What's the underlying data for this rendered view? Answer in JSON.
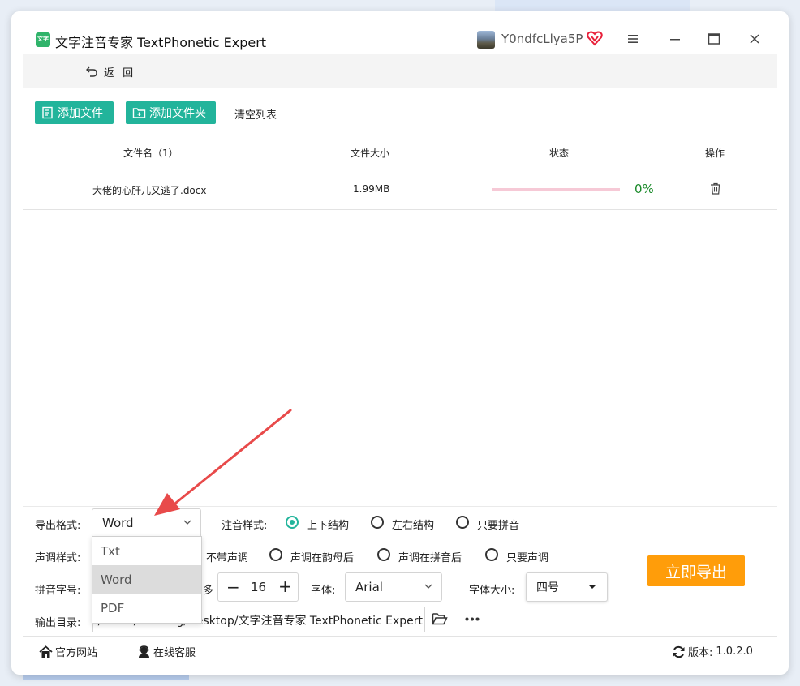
{
  "app": {
    "logo_text": "文字",
    "title": "文字注音专家 TextPhonetic Expert",
    "username": "Y0ndfcLlya5P"
  },
  "nav": {
    "back_label": "返 回"
  },
  "toolbar": {
    "add_file": "添加文件",
    "add_folder": "添加文件夹",
    "clear_list": "清空列表"
  },
  "table": {
    "headers": [
      "文件名（1）",
      "文件大小",
      "状态",
      "操作"
    ],
    "rows": [
      {
        "name": "大佬的心肝儿又逃了.docx",
        "size": "1.99MB",
        "progress": 0,
        "progress_label": "0%"
      }
    ]
  },
  "settings": {
    "export_format_label": "导出格式:",
    "export_format_value": "Word",
    "export_format_options": [
      "Txt",
      "Word",
      "PDF"
    ],
    "phonetic_style_label": "注音样式:",
    "phonetic_style_options": [
      "上下结构",
      "左右结构",
      "只要拼音"
    ],
    "phonetic_style_selected": "上下结构",
    "tone_style_label": "声调样式:",
    "tone_style_options": [
      "不带声调",
      "声调在韵母后",
      "声调在拼音后",
      "只要声调"
    ],
    "pinyin_size_label": "拼音字号:",
    "pinyin_size_partial": "多",
    "pinyin_size_value": "16",
    "font_label": "字体:",
    "font_value": "Arial",
    "font_size_label": "字体大小:",
    "font_size_value": "四号",
    "output_dir_label": "输出目录:",
    "output_dir_value": "C:/Users/huibang/Desktop/文字注音专家 TextPhonetic Expert",
    "export_button": "立即导出"
  },
  "footer": {
    "website": "官方网站",
    "support": "在线客服",
    "version_label": "版本:",
    "version_value": "1.0.2.0"
  },
  "colors": {
    "accent": "#22b49b",
    "export_button": "#ff9d0a",
    "progress_text": "#1a8a2a",
    "progress_track": "#f6c9d6",
    "annotation_arrow": "#e84a4a"
  },
  "icons": [
    "app-logo-icon",
    "vip-heart-icon",
    "menu-icon",
    "minimize-icon",
    "maximize-icon",
    "close-icon",
    "back-icon",
    "add-file-icon",
    "add-folder-icon",
    "trash-icon",
    "chevron-down-icon",
    "caret-down-icon",
    "folder-open-icon",
    "more-icon",
    "home-icon",
    "support-icon",
    "refresh-icon"
  ]
}
